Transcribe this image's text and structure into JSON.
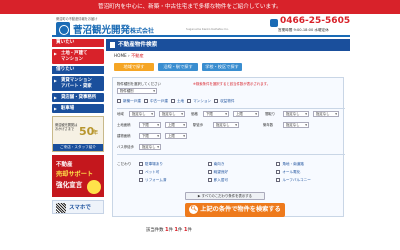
{
  "notice": "菅沼町内を中心に、新築・中古住宅まで多様な物件をご紹介しています。",
  "header": {
    "tagline": "菅沼町の不動産情報をお届け",
    "company_name": "菅沼観光開発",
    "company_suffix": "株式会社",
    "company_roman": "Suganuma Kanko Kaihatsu Co.",
    "phone": "0466-25-5605",
    "hours": "営業時間 9:00-18:00 水曜定休"
  },
  "sidebar": {
    "buy_head": "買いたい",
    "buy_items": [
      "土地・戸建て",
      "マンション"
    ],
    "rent_head": "借りたい",
    "rent_items": [
      "賃貸マンション",
      "アパート・貸家",
      "貸店舗・貸事務所",
      "駐車場"
    ],
    "anniversary": {
      "text": "菅沼観光開発はおかげさまで",
      "number": "50",
      "unit": "年",
      "footer": "ご来店・スタッフ紹介"
    },
    "sell": {
      "line1": "不動産",
      "line2": "売却サポート",
      "line3": "強化宣言"
    },
    "mobile": "スマホで"
  },
  "main": {
    "title": "不動産物件検索",
    "breadcrumb_home": "HOME",
    "breadcrumb_sep": " › ",
    "breadcrumb_current": "不動産",
    "tabs": [
      "地域で探す",
      "沿線・駅で探す",
      "学校・校区で探す"
    ],
    "form": {
      "note": "物件種別を選択してください",
      "note_red": "※検索条件を選択すると該当件数が表示されます。",
      "kind_select": "物件種別",
      "kinds": [
        "新築一戸建",
        "中古一戸建",
        "土地",
        "マンション",
        "収益物件"
      ],
      "area_label": "地域",
      "price_label": "価格",
      "area_select": "指定なし",
      "min_label": "下限",
      "max_label": "上限",
      "land_label": "土地面積",
      "building_label": "建物面積",
      "layout_label": "間取り",
      "walk_label": "駅徒歩",
      "age_label": "築年数",
      "bus_label": "バス停徒歩",
      "features_label": "こだわり",
      "features": [
        "駐車場あり",
        "南向き",
        "角地・南道路",
        "ペット可",
        "眺望良好",
        "オール電化",
        "リフォーム済",
        "即入居可",
        "ルーフバルコニー"
      ],
      "more_label": "▶ すべてのこだわり条件を表示する",
      "search_label": "上記の条件で物件を検索する"
    },
    "result": {
      "prefix": "該当件数",
      "counts": [
        "1",
        "1",
        "1"
      ],
      "unit": "件"
    }
  },
  "colors": {
    "brand_red": "#d8222a",
    "brand_blue": "#1a4f9c",
    "accent_orange": "#ee7a1c"
  },
  "icons": [
    "logo-icon",
    "phone-icon",
    "search-icon",
    "qr-code-icon"
  ]
}
